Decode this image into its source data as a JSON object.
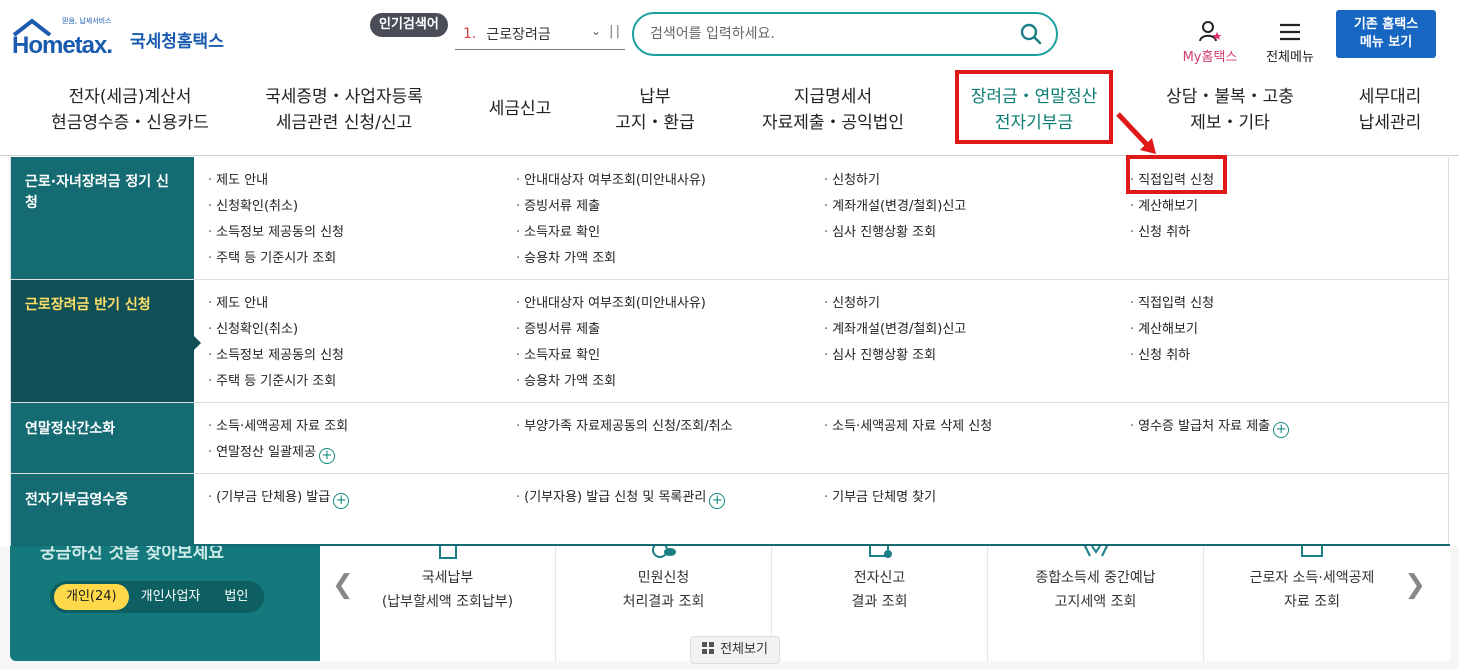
{
  "header": {
    "logo_slogan": "믿음, 납세서비스",
    "logo_en": "Hometax.",
    "logo_kr": "국세청홈택스",
    "popular_label": "인기검색어",
    "popular_rank": "1.",
    "popular_keyword": "근로장려금",
    "search_placeholder": "검색어를 입력하세요.",
    "my_hometax": "My홈택스",
    "all_menu": "전체메뉴",
    "classic_line1": "기존 홈택스",
    "classic_line2": "메뉴 보기"
  },
  "gnb": [
    {
      "line1": "전자(세금)계산서",
      "line2": "현금영수증・신용카드"
    },
    {
      "line1": "국세증명・사업자등록",
      "line2": "세금관련 신청/신고"
    },
    {
      "line1": "세금신고",
      "line2": ""
    },
    {
      "line1": "납부",
      "line2": "고지・환급"
    },
    {
      "line1": "지급명세서",
      "line2": "자료제출・공익법인"
    },
    {
      "line1": "장려금・연말정산",
      "line2": "전자기부금"
    },
    {
      "line1": "상담・불복・고충",
      "line2": "제보・기타"
    },
    {
      "line1": "세무대리",
      "line2": "납세관리"
    }
  ],
  "menu_sections": [
    {
      "title": "근로·자녀장려금 정기 신청",
      "links": [
        "제도 안내",
        "안내대상자 여부조회(미안내사유)",
        "신청하기",
        "직접입력 신청",
        "신청확인(취소)",
        "증빙서류 제출",
        "계좌개설(변경/철회)신고",
        "계산해보기",
        "소득정보 제공동의 신청",
        "소득자료 확인",
        "심사 진행상황 조회",
        "신청 취하",
        "주택 등 기준시가 조회",
        "승용차 가액 조회"
      ]
    },
    {
      "title": "근로장려금 반기 신청",
      "links": [
        "제도 안내",
        "안내대상자 여부조회(미안내사유)",
        "신청하기",
        "직접입력 신청",
        "신청확인(취소)",
        "증빙서류 제출",
        "계좌개설(변경/철회)신고",
        "계산해보기",
        "소득정보 제공동의 신청",
        "소득자료 확인",
        "심사 진행상황 조회",
        "신청 취하",
        "주택 등 기준시가 조회",
        "승용차 가액 조회"
      ]
    },
    {
      "title": "연말정산간소화",
      "links": [
        "소득·세액공제 자료 조회",
        "부양가족 자료제공동의 신청/조회/취소",
        "소득·세액공제 자료 삭제 신청",
        "영수증 발급처 자료 제출",
        "연말정산 일괄제공"
      ]
    },
    {
      "title": "전자기부금영수증",
      "links": [
        "(기부금 단체용) 발급",
        "(기부자용) 발급 신청 및 목록관리",
        "기부금 단체명 찾기"
      ]
    }
  ],
  "bottom": {
    "faded_title": "궁금하신 것을 찾아보세요",
    "tabs": [
      "개인(24)",
      "개인사업자",
      "법인"
    ],
    "quick_items": [
      {
        "line1": "국세납부",
        "line2": "(납부할세액 조회납부)"
      },
      {
        "line1": "민원신청",
        "line2": "처리결과 조회"
      },
      {
        "line1": "전자신고",
        "line2": "결과 조회"
      },
      {
        "line1": "종합소득세 중간예납",
        "line2": "고지세액 조회"
      },
      {
        "line1": "근로자 소득·세액공제",
        "line2": "자료 조회"
      }
    ],
    "view_all": "전체보기"
  },
  "colors": {
    "brand_blue": "#1767c2",
    "teal": "#146c72",
    "highlight_red": "#e01818"
  }
}
